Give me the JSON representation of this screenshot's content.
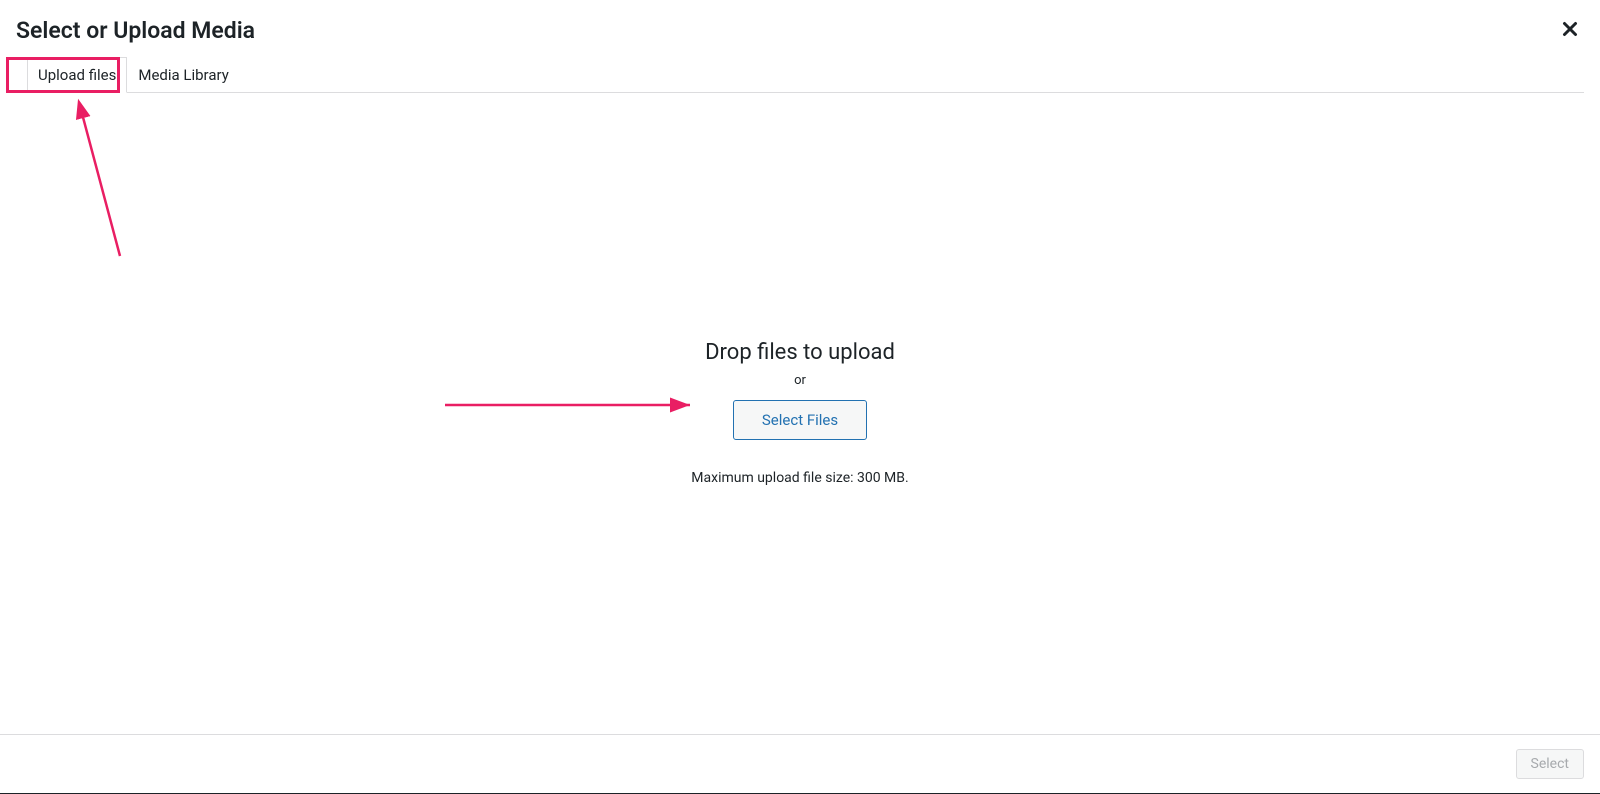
{
  "modal": {
    "title": "Select or Upload Media",
    "tabs": {
      "upload_files": "Upload files",
      "media_library": "Media Library"
    },
    "upload_area": {
      "drop_title": "Drop files to upload",
      "or_text": "or",
      "select_files_button": "Select Files",
      "max_upload_text": "Maximum upload file size: 300 MB."
    },
    "footer": {
      "select_button": "Select"
    }
  }
}
